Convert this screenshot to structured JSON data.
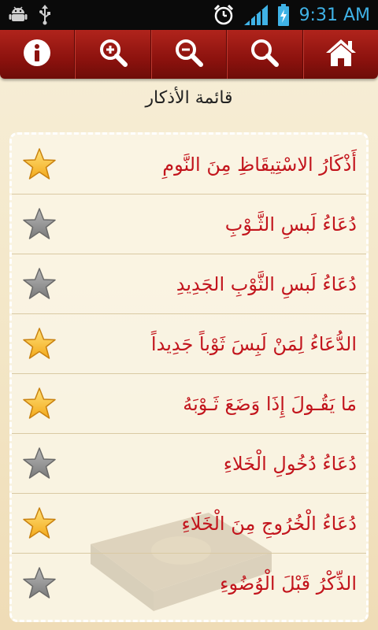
{
  "status_bar": {
    "time": "9:31 AM",
    "left_icons": [
      "android-debug-icon",
      "usb-icon"
    ],
    "right_icons": [
      "alarm-icon",
      "signal-icon",
      "battery-charging-icon"
    ],
    "accent_color": "#3fb2e6"
  },
  "toolbar": {
    "buttons": [
      {
        "name": "info-button",
        "icon": "info-icon"
      },
      {
        "name": "zoom-in-button",
        "icon": "zoom-in-icon"
      },
      {
        "name": "zoom-out-button",
        "icon": "zoom-out-icon"
      },
      {
        "name": "search-button",
        "icon": "search-icon"
      },
      {
        "name": "home-button",
        "icon": "home-icon"
      }
    ],
    "color": "#9b1a14"
  },
  "page": {
    "title": "قائمة الأذكار"
  },
  "list": {
    "text_color": "#c2141c",
    "items": [
      {
        "label": "أَذْكَارُ الاسْتِيقَاظِ مِنَ النَّومِ",
        "favorite": true
      },
      {
        "label": "دُعَاءُ لَبسِ الثَّـوْبِ",
        "favorite": false
      },
      {
        "label": "دُعَاءُ لَبسِ الثَّوْبِ الجَدِيدِ",
        "favorite": false
      },
      {
        "label": "الدُّعَاءُ لِمَنْ لَبِسَ ثَوْباً جَدِيداً",
        "favorite": true
      },
      {
        "label": "مَا يَقُـولَ إِذَا وَضَعَ ثَـوْبَهُ",
        "favorite": true
      },
      {
        "label": "دُعَاءُ دُخُولِ الْخَلاءِ",
        "favorite": false
      },
      {
        "label": "دُعَاءُ الْخُرُوجِ مِنَ الْخَلَاءِ",
        "favorite": true
      },
      {
        "label": "الذِّكْرُ قَبْلَ الْوُضُوءِ",
        "favorite": false
      }
    ]
  }
}
